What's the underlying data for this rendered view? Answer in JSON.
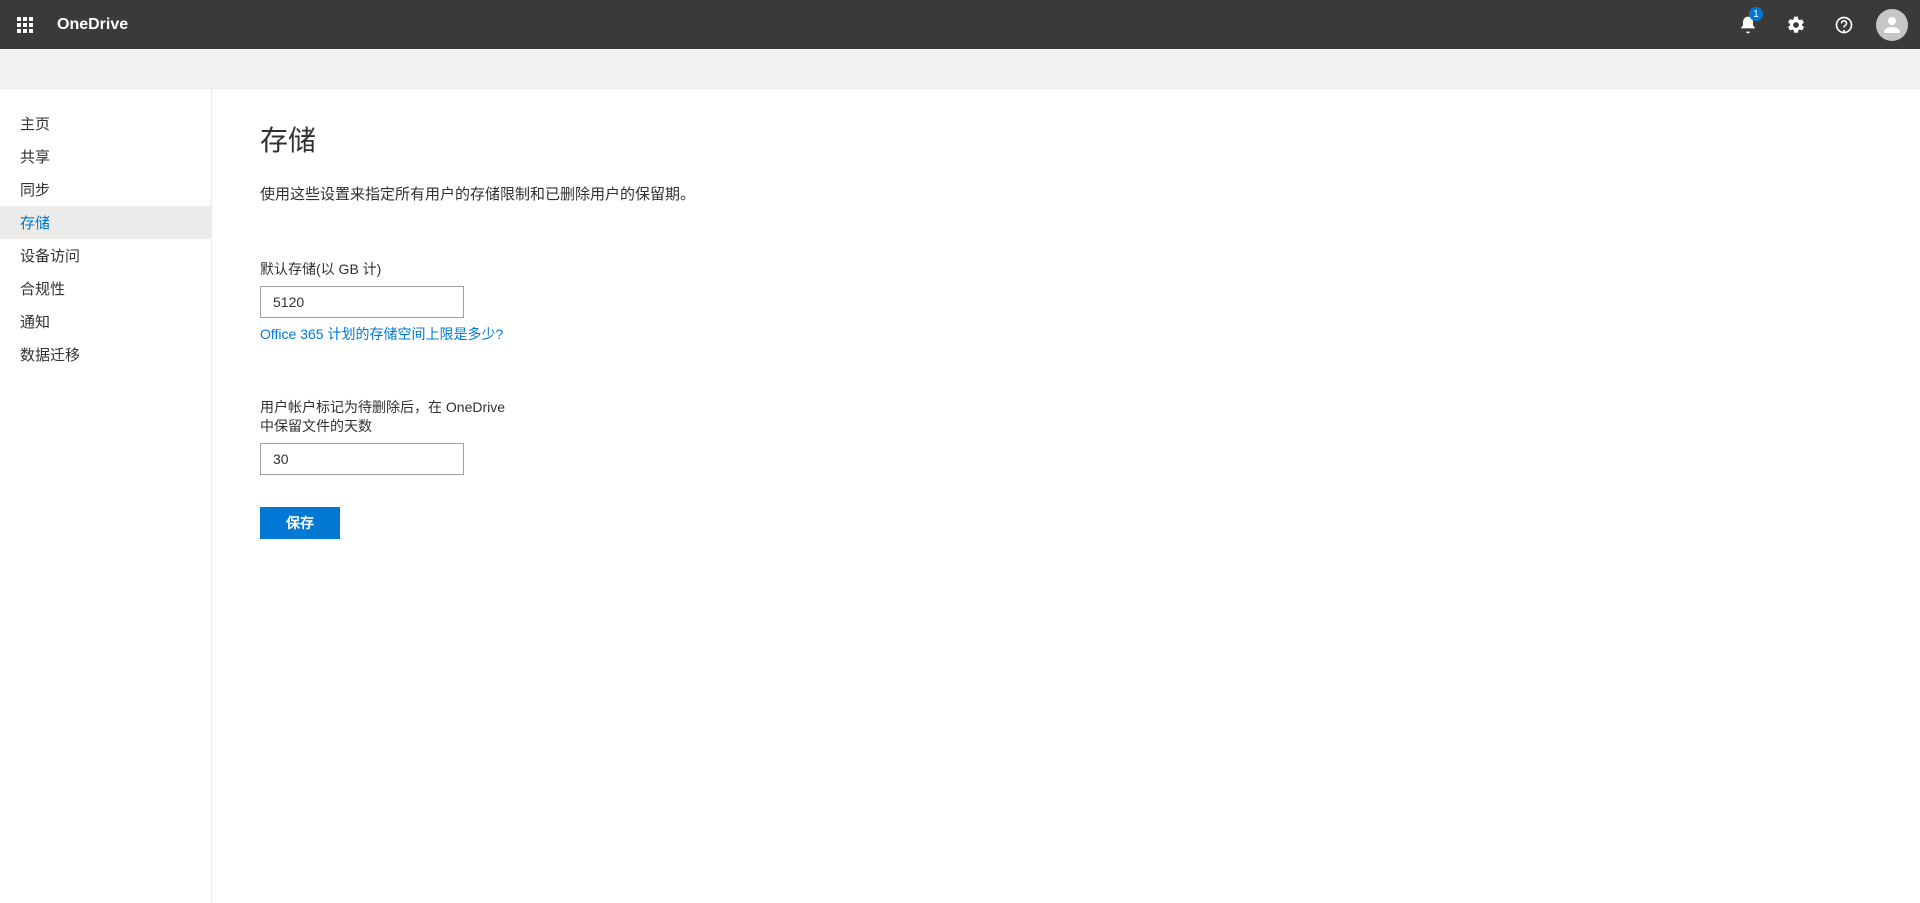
{
  "header": {
    "app_name": "OneDrive",
    "notification_count": "1"
  },
  "sidebar": {
    "items": [
      {
        "label": "主页"
      },
      {
        "label": "共享"
      },
      {
        "label": "同步"
      },
      {
        "label": "存储",
        "active": true
      },
      {
        "label": "设备访问"
      },
      {
        "label": "合规性"
      },
      {
        "label": "通知"
      },
      {
        "label": "数据迁移"
      }
    ]
  },
  "main": {
    "title": "存储",
    "description": "使用这些设置来指定所有用户的存储限制和已删除用户的保留期。",
    "storage_label": "默认存储(以 GB 计)",
    "storage_value": "5120",
    "storage_link": "Office 365 计划的存储空间上限是多少?",
    "retention_label": "用户帐户标记为待删除后，在 OneDrive 中保留文件的天数",
    "retention_value": "30",
    "save_label": "保存"
  }
}
